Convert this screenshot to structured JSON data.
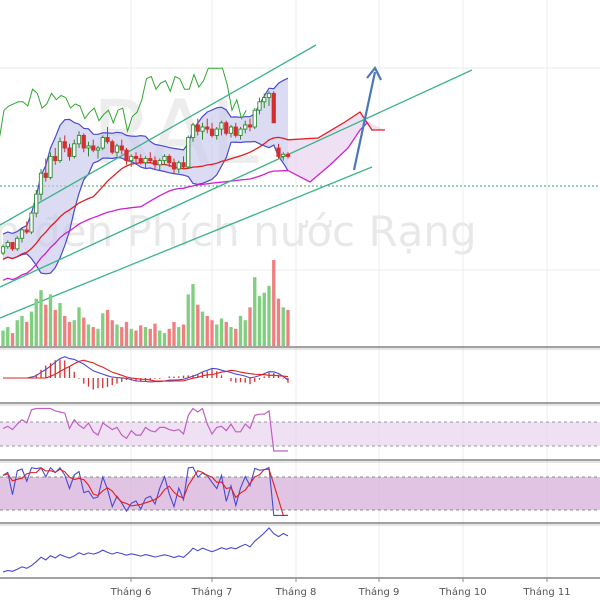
{
  "watermark": {
    "symbol": "RAL",
    "company": "n đèn Phích nước Rạng"
  },
  "colors": {
    "up": "#2e8b2e",
    "down": "#d32f2f",
    "bb": "#4a4ad0",
    "bb_fill": "#c8c8ee",
    "channel": "#3cb389",
    "arrow": "#4a78b8",
    "ichimoku": "#2fa82f",
    "red_line": "#e02020",
    "magenta": "#d020d0",
    "band_fill": "#ead3ee",
    "pivot": "#3a9a6a",
    "vol_up": "#7fcf7f",
    "vol_down": "#f08080"
  },
  "chart_data": {
    "type": "candlestick",
    "x_ticks": [
      "Tháng 6",
      "Tháng 7",
      "Tháng 8",
      "Tháng 9",
      "Tháng 10",
      "Tháng 11"
    ],
    "panels": [
      "price",
      "volume",
      "macd",
      "rsi",
      "stochastic",
      "obv"
    ],
    "candles": [
      [
        10,
        14,
        9,
        13
      ],
      [
        13,
        16,
        12,
        15
      ],
      [
        15,
        15,
        11,
        12
      ],
      [
        12,
        18,
        11,
        17
      ],
      [
        17,
        22,
        15,
        21
      ],
      [
        21,
        25,
        19,
        20
      ],
      [
        20,
        30,
        19,
        29
      ],
      [
        29,
        40,
        27,
        38
      ],
      [
        38,
        50,
        35,
        48
      ],
      [
        48,
        55,
        44,
        46
      ],
      [
        46,
        58,
        45,
        56
      ],
      [
        56,
        60,
        52,
        54
      ],
      [
        54,
        65,
        53,
        63
      ],
      [
        63,
        66,
        58,
        60
      ],
      [
        60,
        62,
        54,
        56
      ],
      [
        56,
        64,
        55,
        62
      ],
      [
        62,
        68,
        60,
        66
      ],
      [
        66,
        67,
        58,
        60
      ],
      [
        60,
        63,
        56,
        61
      ],
      [
        61,
        64,
        58,
        59
      ],
      [
        59,
        61,
        55,
        60
      ],
      [
        60,
        66,
        59,
        65
      ],
      [
        65,
        70,
        62,
        63
      ],
      [
        63,
        64,
        57,
        58
      ],
      [
        58,
        62,
        56,
        61
      ],
      [
        61,
        64,
        57,
        59
      ],
      [
        59,
        60,
        52,
        54
      ],
      [
        54,
        57,
        51,
        56
      ],
      [
        56,
        58,
        53,
        55
      ],
      [
        55,
        57,
        52,
        53
      ],
      [
        53,
        56,
        50,
        55
      ],
      [
        55,
        58,
        53,
        54
      ],
      [
        54,
        56,
        50,
        52
      ],
      [
        52,
        55,
        49,
        54
      ],
      [
        54,
        57,
        52,
        56
      ],
      [
        56,
        57,
        51,
        53
      ],
      [
        53,
        55,
        48,
        50
      ],
      [
        50,
        54,
        48,
        53
      ],
      [
        53,
        56,
        50,
        51
      ],
      [
        51,
        66,
        50,
        65
      ],
      [
        65,
        72,
        63,
        71
      ],
      [
        71,
        74,
        66,
        68
      ],
      [
        68,
        72,
        64,
        70
      ],
      [
        70,
        74,
        67,
        69
      ],
      [
        69,
        72,
        65,
        66
      ],
      [
        66,
        70,
        64,
        69
      ],
      [
        69,
        73,
        66,
        72
      ],
      [
        72,
        73,
        66,
        67
      ],
      [
        67,
        71,
        65,
        70
      ],
      [
        70,
        72,
        65,
        66
      ],
      [
        66,
        70,
        64,
        69
      ],
      [
        69,
        73,
        67,
        71
      ],
      [
        71,
        74,
        68,
        70
      ],
      [
        70,
        79,
        69,
        78
      ],
      [
        78,
        84,
        76,
        82
      ],
      [
        82,
        86,
        79,
        84
      ],
      [
        84,
        87,
        80,
        86
      ],
      [
        86,
        87,
        78,
        72
      ],
      [
        60,
        62,
        55,
        56
      ],
      [
        56,
        58,
        54,
        57
      ],
      [
        57,
        58,
        55,
        56
      ]
    ],
    "volume": [
      18,
      22,
      15,
      30,
      35,
      28,
      40,
      55,
      65,
      48,
      60,
      42,
      50,
      35,
      28,
      30,
      45,
      33,
      25,
      22,
      20,
      38,
      42,
      30,
      25,
      22,
      28,
      20,
      18,
      24,
      22,
      20,
      26,
      18,
      15,
      20,
      28,
      22,
      25,
      60,
      72,
      48,
      40,
      35,
      30,
      25,
      32,
      28,
      22,
      20,
      35,
      30,
      45,
      80,
      58,
      62,
      70,
      100,
      55,
      45,
      42
    ],
    "ylim": [
      0,
      100
    ]
  }
}
